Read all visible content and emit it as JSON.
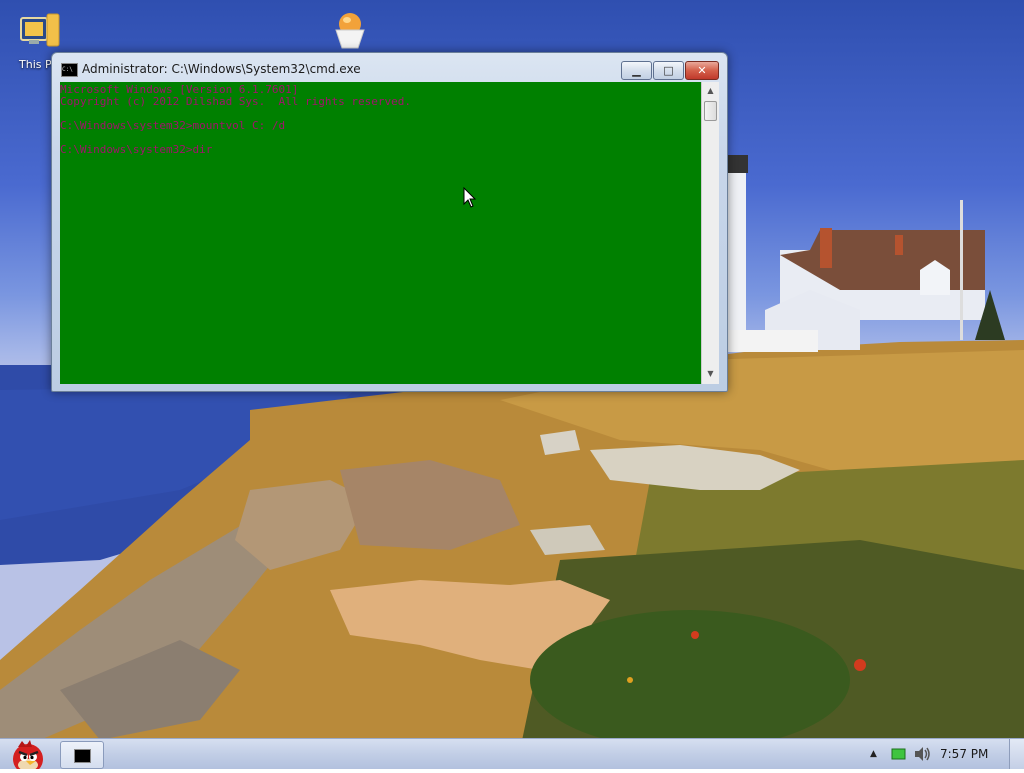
{
  "desktop": {
    "icons": [
      {
        "label": "This P"
      },
      {
        "label": ""
      }
    ]
  },
  "window": {
    "title": "Administrator: C:\\Windows\\System32\\cmd.exe",
    "title_icon_text": "C:\\",
    "buttons": {
      "minimize": "▁",
      "maximize": "□",
      "close": "✕"
    },
    "console_bg": "#008000",
    "console_fg": "#a0136b",
    "lines": [
      "Microsoft Windows [Version 6.1.7601]",
      "Copyright (c) 2012 Dilshad Sys.  All rights reserved.",
      "",
      "C:\\Windows\\system32>mountvol C: /d",
      "",
      "C:\\Windows\\system32>dir"
    ],
    "scroll_up": "▲",
    "scroll_down": "▼"
  },
  "taskbar": {
    "tray_chevron": "▲",
    "clock": "7:57 PM"
  }
}
